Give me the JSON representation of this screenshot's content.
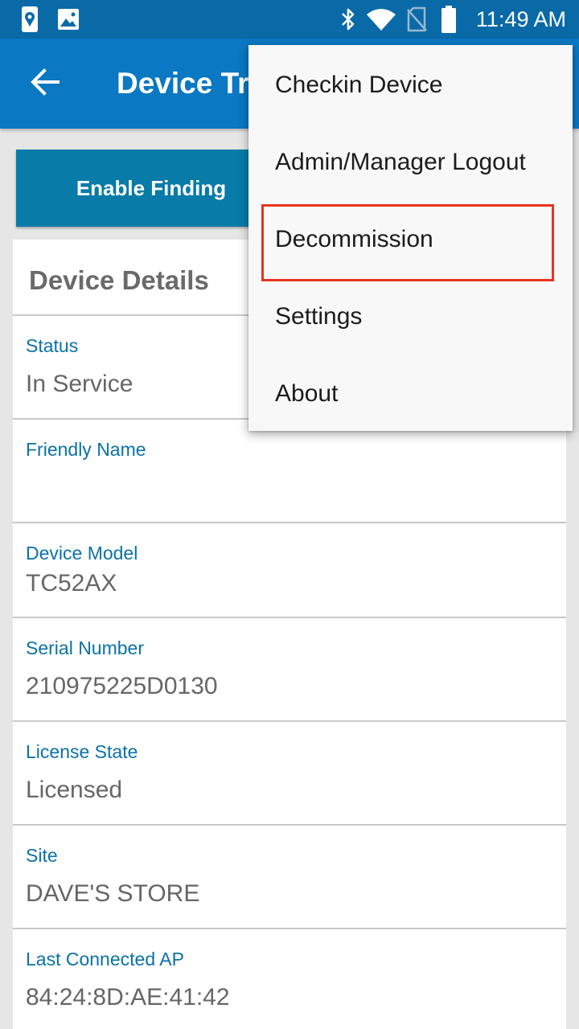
{
  "status_bar": {
    "time": "11:49 AM",
    "left_icons": [
      "location-phone-icon",
      "image-icon"
    ],
    "right_icons": [
      "bluetooth-icon",
      "wifi-icon",
      "no-sim-icon",
      "battery-icon"
    ]
  },
  "app_bar": {
    "title": "Device Tr",
    "back_icon": "arrow-left-icon"
  },
  "main": {
    "enable_finding_label": "Enable Finding",
    "card_title": "Device Details",
    "details": [
      {
        "label": "Status",
        "value": "In Service"
      },
      {
        "label": "Friendly Name",
        "value": ""
      },
      {
        "label": "Device Model",
        "value": "TC52AX"
      },
      {
        "label": "Serial Number",
        "value": "210975225D0130"
      },
      {
        "label": "License State",
        "value": "Licensed"
      },
      {
        "label": "Site",
        "value": "DAVE'S STORE"
      },
      {
        "label": "Last Connected AP",
        "value": "84:24:8D:AE:41:42"
      }
    ]
  },
  "menu": {
    "items": [
      {
        "label": "Checkin Device"
      },
      {
        "label": "Admin/Manager Logout"
      },
      {
        "label": "Decommission"
      },
      {
        "label": "Settings"
      },
      {
        "label": "About"
      }
    ],
    "highlight_color": "#e8341c"
  },
  "colors": {
    "status_bar": "#0a6aa7",
    "app_bar": "#0a78c2",
    "button": "#087ba8",
    "label": "#0a72a8"
  }
}
